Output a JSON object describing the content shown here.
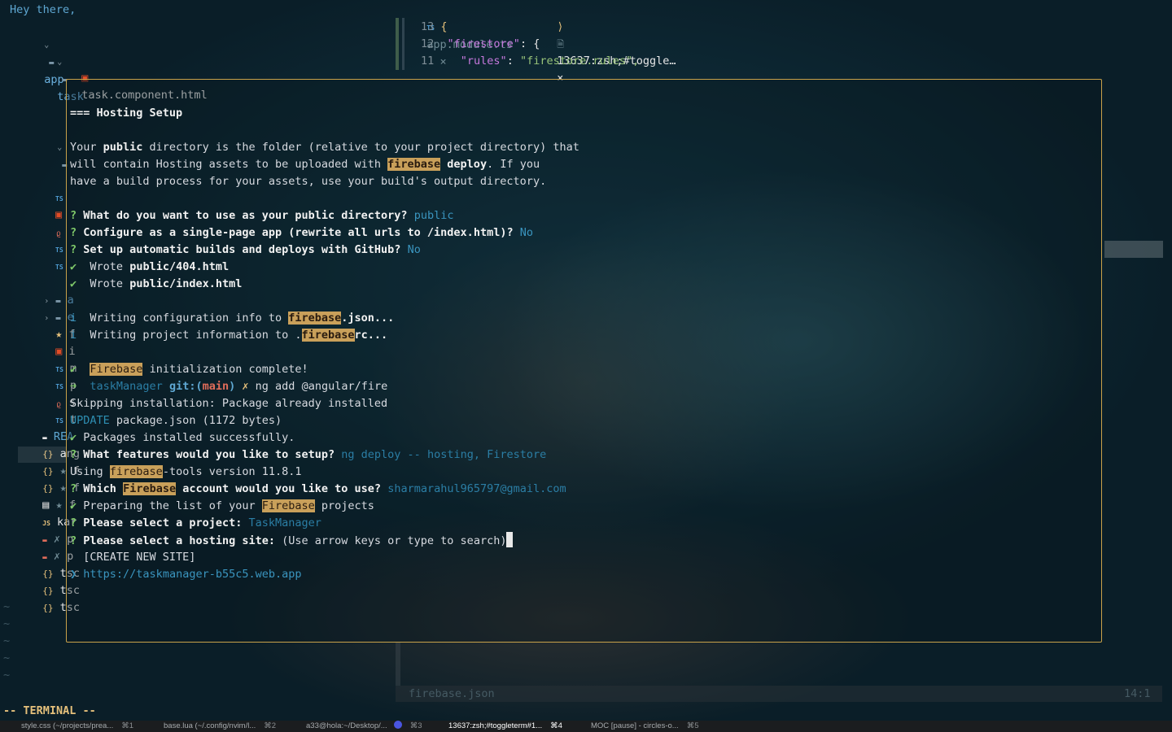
{
  "greeting": "Hey there,",
  "tree": {
    "app": "app",
    "task": "task",
    "task_component": "task.component.html",
    "partials": [
      {
        "name": "a"
      },
      {
        "name": "e"
      },
      {
        "name": "f"
      },
      {
        "name": "i"
      },
      {
        "name": "m"
      },
      {
        "name": "p"
      },
      {
        "name": "s"
      },
      {
        "name": "t"
      },
      {
        "name": "REA"
      },
      {
        "name": "ang"
      },
      {
        "name": "f"
      },
      {
        "name": "f"
      },
      {
        "name": "f"
      },
      {
        "name": "kar"
      },
      {
        "name": "p"
      },
      {
        "name": "p"
      },
      {
        "name": "tsc"
      },
      {
        "name": "tsc"
      },
      {
        "name": "tsc"
      }
    ]
  },
  "editor": {
    "tab1": "app.module.ts",
    "tab2": "13637:zsh;#toggle…",
    "lines": [
      {
        "num": "13",
        "text": "{"
      },
      {
        "num": "12",
        "key": "\"firestore\"",
        "rest": ": {"
      },
      {
        "num": "11",
        "key": "\"rules\"",
        "value": "\"firestore.rules\","
      }
    ]
  },
  "terminal": {
    "heading": "=== Hosting Setup",
    "p1a": "Your ",
    "p1b": "public",
    "p1c": " directory is the folder (relative to your project directory) that",
    "p2a": "will contain Hosting assets to be uploaded with ",
    "p2b": "firebase",
    "p2c": " deploy",
    "p2d": ". If you",
    "p3": "have a build process for your assets, use your build's output directory.",
    "q1": "What do you want to use as your public directory?",
    "a1": "public",
    "q2": "Configure as a single-page app (rewrite all urls to /index.html)?",
    "a2": "No",
    "q3": "Set up automatic builds and deploys with GitHub?",
    "a3": "No",
    "w1a": " Wrote ",
    "w1b": "public/404.html",
    "w2b": "public/index.html",
    "i1a": " Writing configuration info to ",
    "i1b": "firebase",
    "i1c": ".json...",
    "i2a": " Writing project information to .",
    "i2b": "firebase",
    "i2c": "rc...",
    "done_a": "Firebase",
    "done_b": " initialization complete!",
    "prompt_dir": "taskManager",
    "prompt_git": "git:(",
    "prompt_branch": "main",
    "prompt_git_end": ")",
    "prompt_x": "✗",
    "cmd": "ng add @angular/fire",
    "skip": "Skipping installation: Package already installed",
    "update_a": "UPDATE",
    "update_b": " package.json (1172 bytes)",
    "pkg": " Packages installed successfully.",
    "q4": "What features would you like to setup?",
    "a4": "ng deploy -- hosting, Firestore",
    "using_a": "Using ",
    "using_b": "firebase",
    "using_c": "-tools version 11.8.1",
    "q5a": "Which ",
    "q5b": "Firebase",
    "q5c": " account would you like to use?",
    "a5": "sharmarahul965797@gmail.com",
    "prep_a": " Preparing the list of your ",
    "prep_b": "Firebase",
    "prep_c": " projects",
    "q6": "Please select a project:",
    "a6": "TaskManager",
    "q7": "Please select a hosting site:",
    "q7_hint": " (Use arrow keys or type to search)",
    "opt1": "[CREATE NEW SITE]",
    "opt2": "https://taskmanager-b55c5.web.app"
  },
  "status": {
    "file": "firebase.json",
    "pos": "14:1"
  },
  "mode": "-- TERMINAL --",
  "tabs": [
    {
      "label": "style.css (~/projects/prea...",
      "key": "⌘1"
    },
    {
      "label": "base.lua (~/.config/nvim/l...",
      "key": "⌘2"
    },
    {
      "label": "a33@hola:~/Desktop/...",
      "key": "⌘3"
    },
    {
      "label": "13637:zsh;#toggleterm#1...",
      "key": "⌘4"
    },
    {
      "label": "MOC [pause] - circles-o...",
      "key": "⌘5"
    }
  ],
  "colors": {
    "float_border": "#c9a24a",
    "highlight": "#c9a05a",
    "prompt_green": "#7fc96a",
    "answer_blue": "#3a95bf"
  }
}
